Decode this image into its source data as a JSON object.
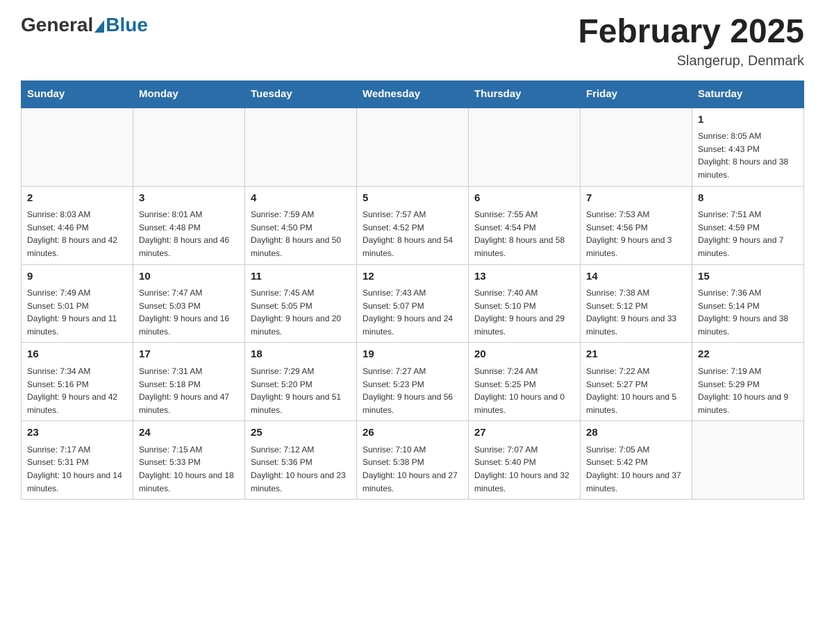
{
  "header": {
    "logo": {
      "general": "General",
      "blue": "Blue"
    },
    "title": "February 2025",
    "location": "Slangerup, Denmark"
  },
  "weekdays": [
    "Sunday",
    "Monday",
    "Tuesday",
    "Wednesday",
    "Thursday",
    "Friday",
    "Saturday"
  ],
  "weeks": [
    [
      {
        "day": "",
        "info": ""
      },
      {
        "day": "",
        "info": ""
      },
      {
        "day": "",
        "info": ""
      },
      {
        "day": "",
        "info": ""
      },
      {
        "day": "",
        "info": ""
      },
      {
        "day": "",
        "info": ""
      },
      {
        "day": "1",
        "info": "Sunrise: 8:05 AM\nSunset: 4:43 PM\nDaylight: 8 hours and 38 minutes."
      }
    ],
    [
      {
        "day": "2",
        "info": "Sunrise: 8:03 AM\nSunset: 4:46 PM\nDaylight: 8 hours and 42 minutes."
      },
      {
        "day": "3",
        "info": "Sunrise: 8:01 AM\nSunset: 4:48 PM\nDaylight: 8 hours and 46 minutes."
      },
      {
        "day": "4",
        "info": "Sunrise: 7:59 AM\nSunset: 4:50 PM\nDaylight: 8 hours and 50 minutes."
      },
      {
        "day": "5",
        "info": "Sunrise: 7:57 AM\nSunset: 4:52 PM\nDaylight: 8 hours and 54 minutes."
      },
      {
        "day": "6",
        "info": "Sunrise: 7:55 AM\nSunset: 4:54 PM\nDaylight: 8 hours and 58 minutes."
      },
      {
        "day": "7",
        "info": "Sunrise: 7:53 AM\nSunset: 4:56 PM\nDaylight: 9 hours and 3 minutes."
      },
      {
        "day": "8",
        "info": "Sunrise: 7:51 AM\nSunset: 4:59 PM\nDaylight: 9 hours and 7 minutes."
      }
    ],
    [
      {
        "day": "9",
        "info": "Sunrise: 7:49 AM\nSunset: 5:01 PM\nDaylight: 9 hours and 11 minutes."
      },
      {
        "day": "10",
        "info": "Sunrise: 7:47 AM\nSunset: 5:03 PM\nDaylight: 9 hours and 16 minutes."
      },
      {
        "day": "11",
        "info": "Sunrise: 7:45 AM\nSunset: 5:05 PM\nDaylight: 9 hours and 20 minutes."
      },
      {
        "day": "12",
        "info": "Sunrise: 7:43 AM\nSunset: 5:07 PM\nDaylight: 9 hours and 24 minutes."
      },
      {
        "day": "13",
        "info": "Sunrise: 7:40 AM\nSunset: 5:10 PM\nDaylight: 9 hours and 29 minutes."
      },
      {
        "day": "14",
        "info": "Sunrise: 7:38 AM\nSunset: 5:12 PM\nDaylight: 9 hours and 33 minutes."
      },
      {
        "day": "15",
        "info": "Sunrise: 7:36 AM\nSunset: 5:14 PM\nDaylight: 9 hours and 38 minutes."
      }
    ],
    [
      {
        "day": "16",
        "info": "Sunrise: 7:34 AM\nSunset: 5:16 PM\nDaylight: 9 hours and 42 minutes."
      },
      {
        "day": "17",
        "info": "Sunrise: 7:31 AM\nSunset: 5:18 PM\nDaylight: 9 hours and 47 minutes."
      },
      {
        "day": "18",
        "info": "Sunrise: 7:29 AM\nSunset: 5:20 PM\nDaylight: 9 hours and 51 minutes."
      },
      {
        "day": "19",
        "info": "Sunrise: 7:27 AM\nSunset: 5:23 PM\nDaylight: 9 hours and 56 minutes."
      },
      {
        "day": "20",
        "info": "Sunrise: 7:24 AM\nSunset: 5:25 PM\nDaylight: 10 hours and 0 minutes."
      },
      {
        "day": "21",
        "info": "Sunrise: 7:22 AM\nSunset: 5:27 PM\nDaylight: 10 hours and 5 minutes."
      },
      {
        "day": "22",
        "info": "Sunrise: 7:19 AM\nSunset: 5:29 PM\nDaylight: 10 hours and 9 minutes."
      }
    ],
    [
      {
        "day": "23",
        "info": "Sunrise: 7:17 AM\nSunset: 5:31 PM\nDaylight: 10 hours and 14 minutes."
      },
      {
        "day": "24",
        "info": "Sunrise: 7:15 AM\nSunset: 5:33 PM\nDaylight: 10 hours and 18 minutes."
      },
      {
        "day": "25",
        "info": "Sunrise: 7:12 AM\nSunset: 5:36 PM\nDaylight: 10 hours and 23 minutes."
      },
      {
        "day": "26",
        "info": "Sunrise: 7:10 AM\nSunset: 5:38 PM\nDaylight: 10 hours and 27 minutes."
      },
      {
        "day": "27",
        "info": "Sunrise: 7:07 AM\nSunset: 5:40 PM\nDaylight: 10 hours and 32 minutes."
      },
      {
        "day": "28",
        "info": "Sunrise: 7:05 AM\nSunset: 5:42 PM\nDaylight: 10 hours and 37 minutes."
      },
      {
        "day": "",
        "info": ""
      }
    ]
  ]
}
